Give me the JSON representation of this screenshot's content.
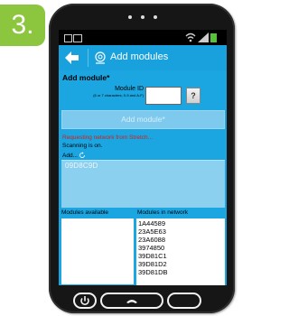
{
  "step_badge": "3.",
  "app": {
    "title": "Add modules",
    "heading": "Add module*",
    "module_id_label": "Module ID",
    "module_id_hint": "(6 or 7 characters; 0-9 and A-F)",
    "module_id_value": "",
    "help_label": "?",
    "add_button_label": "Add module*",
    "requesting_text": "Requesting network from Stretch...",
    "scanning_text": "Scanning is on.",
    "add_label": "Add...",
    "found_items": [
      "09D8C9D"
    ],
    "available_header": "Modules available",
    "network_header": "Modules in network",
    "network_items": [
      "1A44589",
      "23A5E63",
      "23A6088",
      "3974850",
      "39D81C1",
      "39D81D2",
      "39D81DB"
    ]
  },
  "colors": {
    "accent": "#19a1dd",
    "content_bg": "#1ba6e2",
    "badge": "#8cc63e",
    "status_red": "#c8231f",
    "battery": "#58c23a"
  },
  "icons": {
    "back": "back-arrow-icon",
    "app": "module-app-icon",
    "refresh": "refresh-icon",
    "wifi": "wifi-icon",
    "signal": "signal-icon",
    "battery": "battery-icon",
    "power": "power-icon",
    "call": "call-icon"
  }
}
